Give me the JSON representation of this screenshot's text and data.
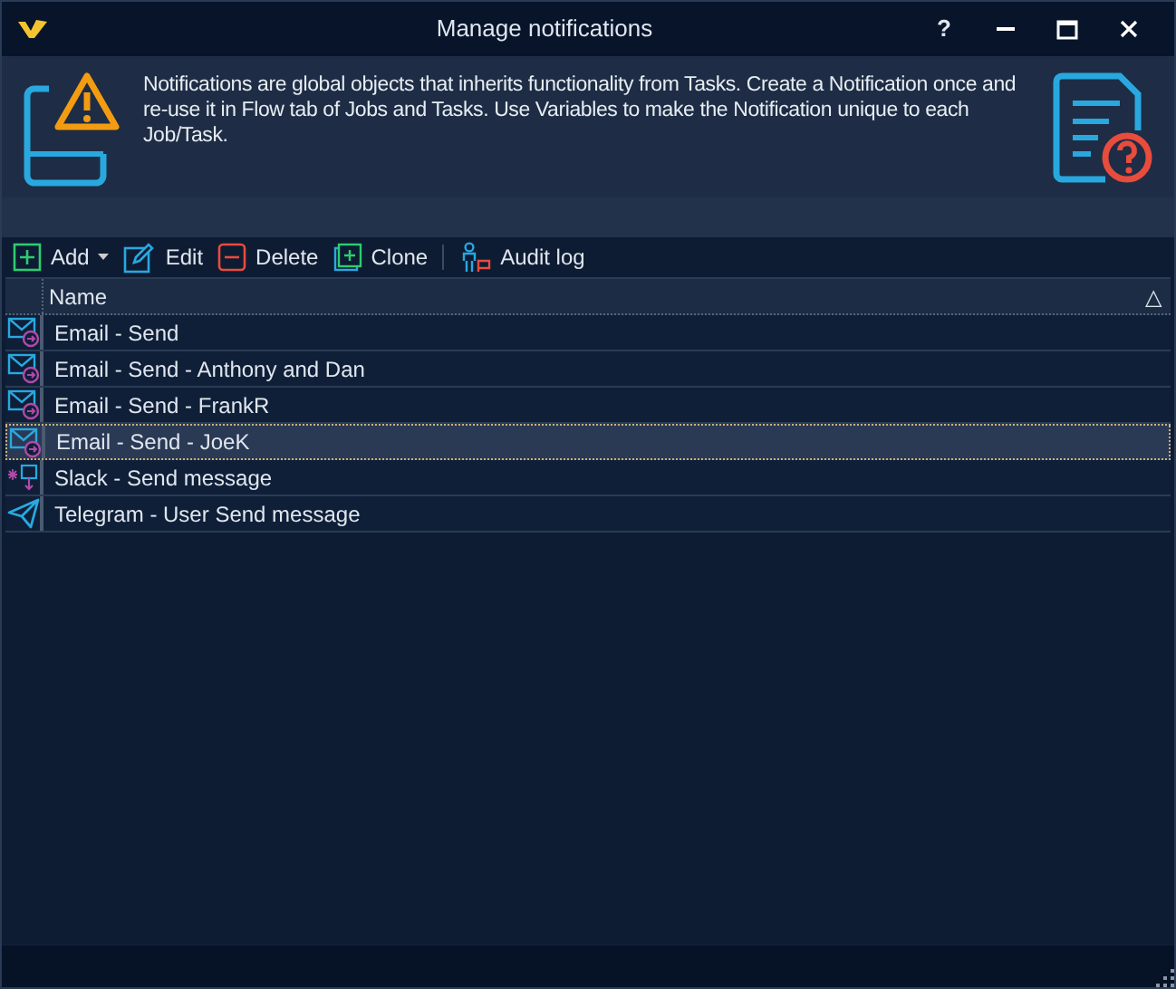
{
  "window": {
    "title": "Manage notifications",
    "controls": [
      "?"
    ]
  },
  "banner": {
    "text": "Notifications are global objects that inherits functionality from Tasks. Create a Notification once and re-use it in Flow tab of Jobs and Tasks. Use Variables to make the Notification unique to each Job/Task."
  },
  "toolbar": [
    {
      "kind": "add",
      "label": "Add"
    },
    {
      "kind": "edit",
      "label": "Edit"
    },
    {
      "kind": "delete",
      "label": "Delete"
    },
    {
      "kind": "clone",
      "label": "Clone"
    },
    {
      "kind": "audit",
      "label": "Audit log"
    }
  ],
  "table": {
    "columns": [
      {
        "label": "Name",
        "sort": "△"
      }
    ],
    "rows": [
      {
        "kind": "email",
        "name": "Email - Send",
        "selected": false
      },
      {
        "kind": "email",
        "name": "Email - Send - Anthony and Dan",
        "selected": false
      },
      {
        "kind": "email",
        "name": "Email - Send - FrankR",
        "selected": false
      },
      {
        "kind": "email",
        "name": "Email - Send - JoeK",
        "selected": true
      },
      {
        "kind": "slack",
        "name": "Slack - Send message",
        "selected": false
      },
      {
        "kind": "telegram",
        "name": "Telegram - User Send message",
        "selected": false
      }
    ]
  }
}
